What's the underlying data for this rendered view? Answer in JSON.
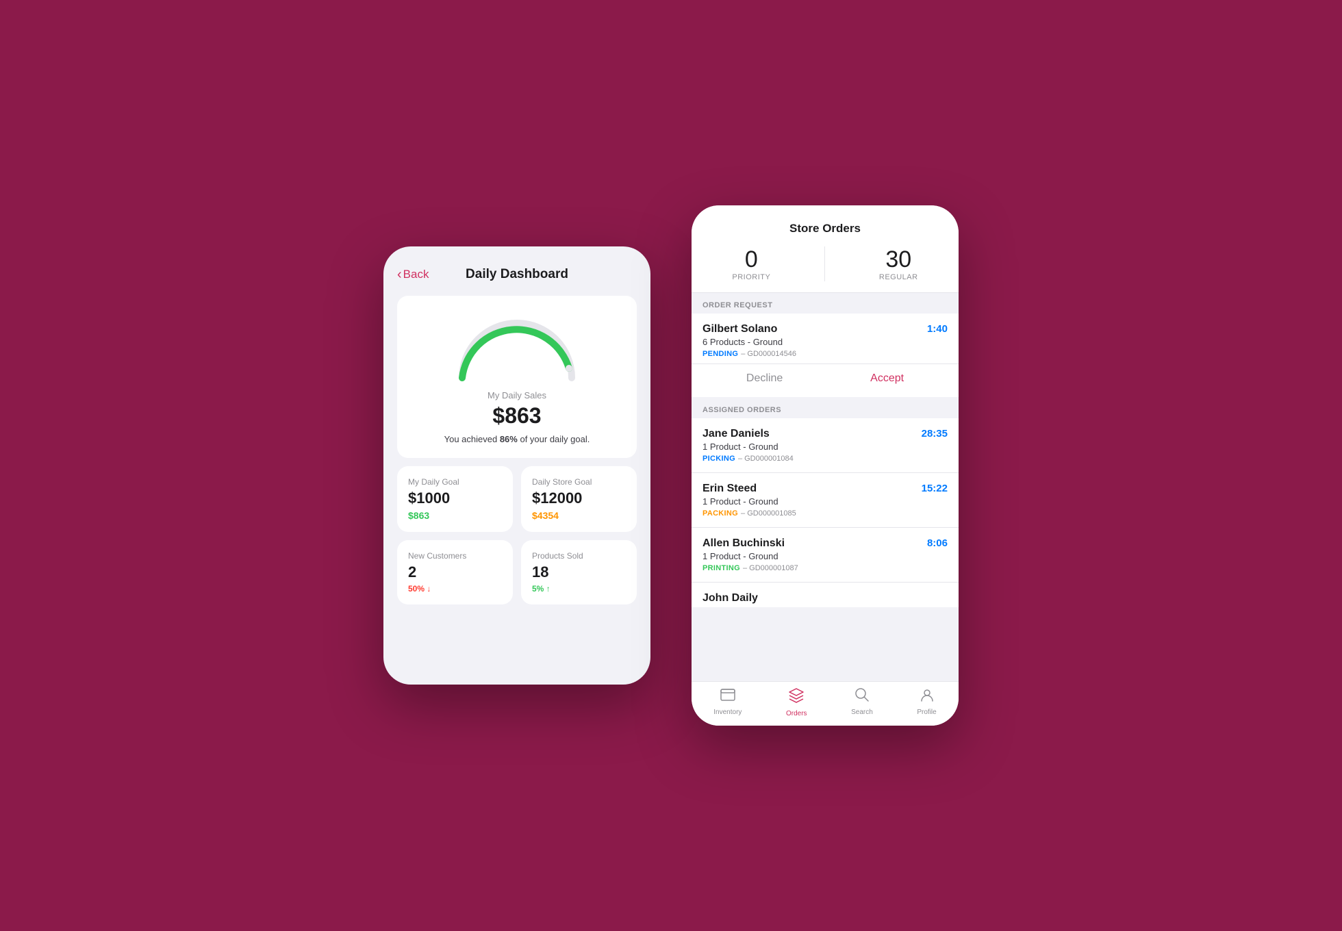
{
  "background": "#8B1A4A",
  "leftPhone": {
    "back_label": "Back",
    "title": "Daily Dashboard",
    "gauge": {
      "label": "My Daily Sales",
      "value": "$863",
      "subtext_prefix": "You achieved ",
      "percent": "86%",
      "subtext_suffix": " of your daily goal.",
      "progress": 86
    },
    "stats": [
      {
        "label": "My Daily Goal",
        "main": "$1000",
        "sub": "$863",
        "sub_color": "green"
      },
      {
        "label": "Daily Store Goal",
        "main": "$12000",
        "sub": "$4354",
        "sub_color": "orange"
      },
      {
        "label": "New Customers",
        "main": "2",
        "sub": "50%",
        "sub_color": "red",
        "arrow": "↓"
      },
      {
        "label": "Products Sold",
        "main": "18",
        "sub": "5%",
        "sub_color": "green",
        "arrow": "↑"
      }
    ]
  },
  "rightPhone": {
    "title": "Store Orders",
    "priority_count": "0",
    "priority_label": "PRIORITY",
    "regular_count": "30",
    "regular_label": "REGULAR",
    "sections": [
      {
        "header": "ORDER REQUEST",
        "orders": [
          {
            "name": "Gilbert Solano",
            "products": "6 Products - Ground",
            "status": "PENDING",
            "status_class": "status-pending",
            "id": "GD000014546",
            "timer": "1:40",
            "has_actions": true
          }
        ]
      },
      {
        "header": "ASSIGNED ORDERS",
        "orders": [
          {
            "name": "Jane Daniels",
            "products": "1 Product - Ground",
            "status": "PICKING",
            "status_class": "status-picking",
            "id": "GD000001084",
            "timer": "28:35"
          },
          {
            "name": "Erin Steed",
            "products": "1 Product - Ground",
            "status": "PACKING",
            "status_class": "status-packing",
            "id": "GD000001085",
            "timer": "15:22"
          },
          {
            "name": "Allen Buchinski",
            "products": "1 Product - Ground",
            "status": "PRINTING",
            "status_class": "status-printing",
            "id": "GD000001087",
            "timer": "8:06"
          },
          {
            "name": "John Daily",
            "products": "",
            "status": "",
            "status_class": "",
            "id": "",
            "timer": "",
            "partial": true
          }
        ]
      }
    ],
    "nav": [
      {
        "icon": "🗂",
        "label": "Inventory",
        "active": false
      },
      {
        "icon": "📦",
        "label": "Orders",
        "active": true
      },
      {
        "icon": "🔍",
        "label": "Search",
        "active": false
      },
      {
        "icon": "👤",
        "label": "Profile",
        "active": false
      }
    ],
    "decline_label": "Decline",
    "accept_label": "Accept"
  }
}
